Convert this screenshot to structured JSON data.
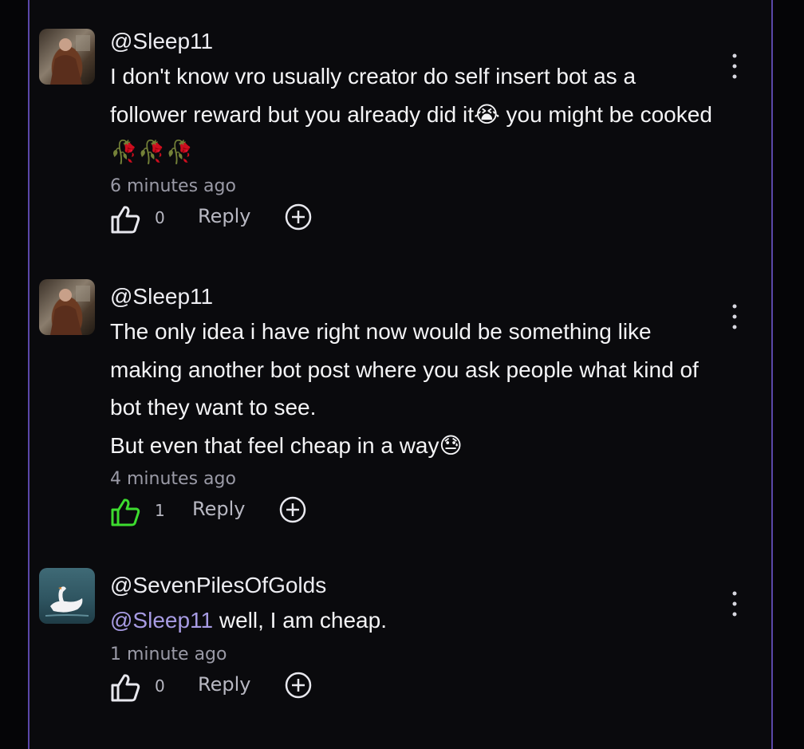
{
  "comments": [
    {
      "username": "@Sleep11",
      "text": "I don't know vro usually creator do self insert bot as a follower reward but you already did it😭 you might be cooked🥀🥀🥀",
      "time": "6 minutes ago",
      "likes": "0",
      "liked": false,
      "reply_label": "Reply",
      "avatar": "person-avatar"
    },
    {
      "username": "@Sleep11",
      "text": "The only idea i have right now would be something like making another bot post where you ask people what kind of bot they want to see.\nBut even that feel cheap in a way😓",
      "time": "4 minutes ago",
      "likes": "1",
      "liked": true,
      "reply_label": "Reply",
      "avatar": "person-avatar"
    },
    {
      "username": "@SevenPilesOfGolds",
      "mention": "@Sleep11",
      "text": " well, I am cheap.",
      "time": "1 minute ago",
      "likes": "0",
      "liked": false,
      "reply_label": "Reply",
      "avatar": "swan-avatar"
    }
  ],
  "colors": {
    "liked": "#3ddc2f",
    "unliked": "#e8e8ee",
    "mention": "#a79be3",
    "border": "#5a47a8"
  },
  "icons": {
    "like": "thumbs-up-icon",
    "add": "plus-circle-icon",
    "menu": "more-vertical-icon"
  }
}
